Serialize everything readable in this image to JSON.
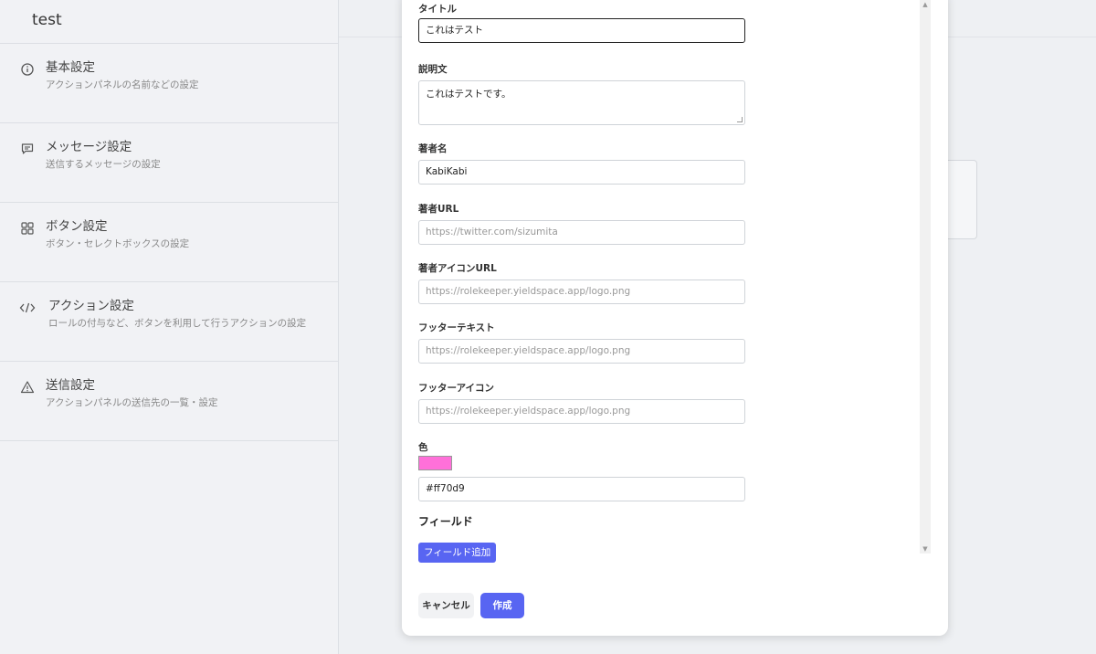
{
  "app": {
    "title": "test"
  },
  "sidebar": {
    "items": [
      {
        "label": "基本設定",
        "desc": "アクションパネルの名前などの設定",
        "icon": "info-icon"
      },
      {
        "label": "メッセージ設定",
        "desc": "送信するメッセージの設定",
        "icon": "message-icon"
      },
      {
        "label": "ボタン設定",
        "desc": "ボタン・セレクトボックスの設定",
        "icon": "grid-icon"
      },
      {
        "label": "アクション設定",
        "desc": "ロールの付与など、ボタンを利用して行うアクションの設定",
        "icon": "code-icon"
      },
      {
        "label": "送信設定",
        "desc": "アクションパネルの送信先の一覧・設定",
        "icon": "warning-icon"
      }
    ]
  },
  "form": {
    "title": {
      "label": "タイトル",
      "value": "これはテスト"
    },
    "description": {
      "label": "説明文",
      "value": "これはテストです。"
    },
    "author_name": {
      "label": "著者名",
      "value": "KabiKabi"
    },
    "author_url": {
      "label": "著者URL",
      "placeholder": "https://twitter.com/sizumita"
    },
    "author_icon_url": {
      "label": "著者アイコンURL",
      "placeholder": "https://rolekeeper.yieldspace.app/logo.png"
    },
    "footer_text": {
      "label": "フッターテキスト",
      "placeholder": "https://rolekeeper.yieldspace.app/logo.png"
    },
    "footer_icon": {
      "label": "フッターアイコン",
      "placeholder": "https://rolekeeper.yieldspace.app/logo.png"
    },
    "color": {
      "label": "色",
      "value": "#ff70d9",
      "swatch": "#ff70d9"
    },
    "fields": {
      "title": "フィールド",
      "add_label": "フィールド追加"
    }
  },
  "footer": {
    "cancel_label": "キャンセル",
    "create_label": "作成"
  },
  "colors": {
    "accent": "#5865f2"
  }
}
